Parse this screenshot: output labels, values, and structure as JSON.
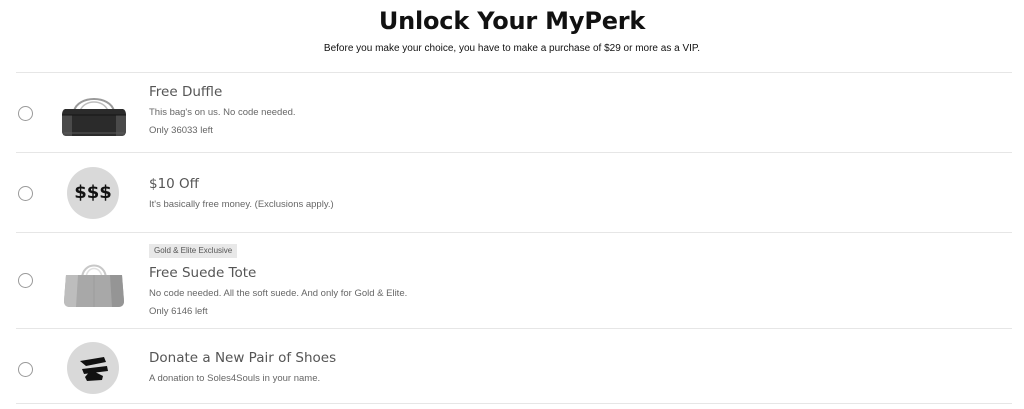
{
  "page": {
    "title": "Unlock Your MyPerk",
    "subtitle": "Before you make your choice, you have to make a purchase of $29 or more as a VIP."
  },
  "perks": [
    {
      "name": "Free Duffle",
      "description": "This bag's on us. No code needed.",
      "stock": "Only 36033 left",
      "icon": "duffle-bag-icon",
      "selected": false
    },
    {
      "name": "$10 Off",
      "description": "It's basically free money. (Exclusions apply.)",
      "icon_text": "$$$",
      "icon": "dollar-signs-icon",
      "selected": false
    },
    {
      "badge": "Gold & Elite Exclusive",
      "name": "Free Suede Tote",
      "description": "No code needed. All the soft suede. And only for Gold & Elite.",
      "stock": "Only 6146 left",
      "icon": "tote-bag-icon",
      "selected": false
    },
    {
      "name": "Donate a New Pair of Shoes",
      "description": "A donation to Soles4Souls in your name.",
      "icon": "soles4souls-shoe-logo-icon",
      "selected": false
    }
  ],
  "colors": {
    "background": "#ffffff",
    "divider": "#e6e6e6",
    "icon_circle": "#d9d9d9",
    "badge_bg": "#e8e8e8"
  }
}
